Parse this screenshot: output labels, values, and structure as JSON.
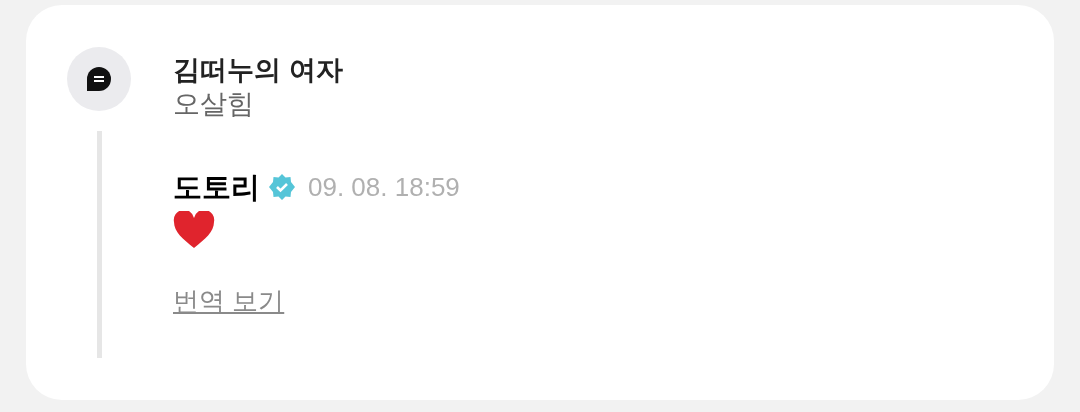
{
  "original_post": {
    "author": "김떠누의 여자",
    "text": "오살힘"
  },
  "reply": {
    "author": "도토리",
    "verified": true,
    "time": "09. 08. 18:59",
    "link": "번역 보기"
  }
}
